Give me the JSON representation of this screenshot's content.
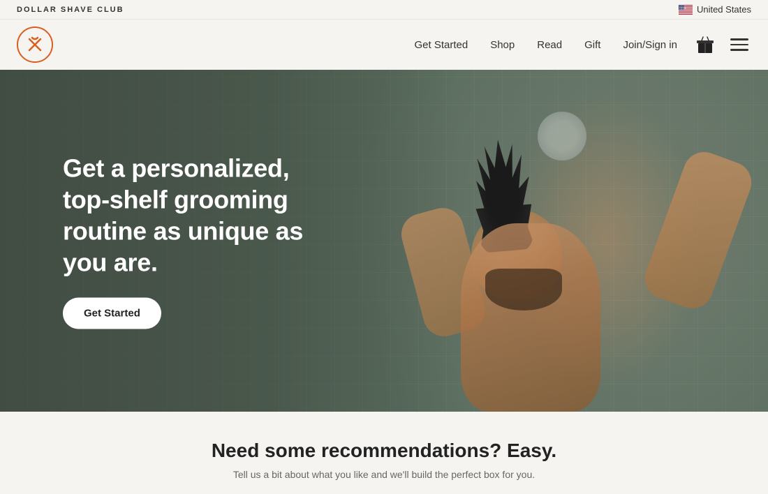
{
  "brand": {
    "name": "DOLLAR SHAVE CLUB",
    "logo_alt": "Dollar Shave Club Logo"
  },
  "top_bar": {
    "locale": "United States"
  },
  "nav": {
    "links": [
      {
        "label": "Get Started",
        "id": "get-started"
      },
      {
        "label": "Shop",
        "id": "shop"
      },
      {
        "label": "Read",
        "id": "read"
      },
      {
        "label": "Gift",
        "id": "gift"
      },
      {
        "label": "Join/Sign in",
        "id": "join-sign-in"
      }
    ]
  },
  "hero": {
    "headline": "Get a personalized, top-shelf grooming routine as unique as you are.",
    "cta_label": "Get Started"
  },
  "recommendations": {
    "title": "Need some recommendations? Easy.",
    "subtitle": "Tell us a bit about what you like and we'll build the perfect box for you."
  }
}
